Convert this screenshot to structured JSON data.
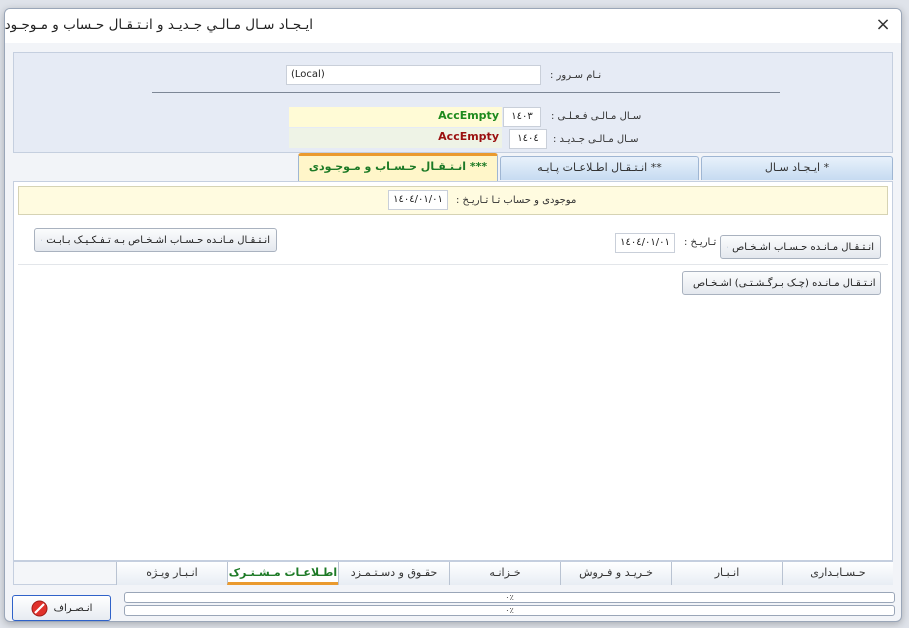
{
  "window": {
    "title": "ایـجـاد سـال مـالـي جـديـد و انـتـقـال حـساب و مـوجـودي",
    "close": "×"
  },
  "header": {
    "server_label": "نـام سـرور :",
    "server_value": "(Local)",
    "current_year_label": "سـال مـالـی فـعـلـی :",
    "current_year_value": "۱٤۰۳",
    "current_db": "AccEmpty",
    "new_year_label": "سـال مـالـی جـدیـد :",
    "new_year_value": "۱٤۰٤",
    "new_db": "AccEmpty"
  },
  "top_tabs": [
    {
      "label": "* ایـجـاد سـال",
      "active": false
    },
    {
      "label": "** انـتـقـال اطـلاعـات پـایـه",
      "active": false
    },
    {
      "label": "*** انـتـقـال حـسـاب و مـوجـودی",
      "active": true
    }
  ],
  "transfer": {
    "balance_label": "موجودی و حساب تـا تـاریـخ :",
    "balance_date": "۱٤۰٤/۰۱/۰۱",
    "date_label": "تـاریـخ :",
    "date_value": "۱٤۰٤/۰۱/۰۱",
    "btn_person_balance": "انـتـقـال مـانـده حـسـاب اشـخـاص",
    "btn_person_balance_itemized": "انـتـقـال مـانـده حـسـاب اشـخـاص بـه تـفـکـیـک بـابـت",
    "btn_returned_cheque": "انـتـقـال مـانـده (چـک بـرگـشـتـی) اشـخـاص"
  },
  "bottom_tabs": [
    {
      "label": "حـسـابـداری",
      "active": false
    },
    {
      "label": "انـبـار",
      "active": false
    },
    {
      "label": "خـریـد و فـروش",
      "active": false
    },
    {
      "label": "خـزانـه",
      "active": false
    },
    {
      "label": "حقـوق و دسـتـمـزد",
      "active": false
    },
    {
      "label": "اطـلاعـات مـشـتـرک",
      "active": true
    },
    {
      "label": "انـبـار ویـژه",
      "active": false
    }
  ],
  "footer": {
    "cancel_label": "انـصـراف",
    "progress1": "۰٪",
    "progress2": "۰٪",
    "progress1_value": 0,
    "progress2_value": 0
  },
  "colors": {
    "current_db": "#1d8a1d",
    "new_db": "#9b1010",
    "current_strip": "#fffbd6",
    "new_strip": "#eef3e6"
  }
}
